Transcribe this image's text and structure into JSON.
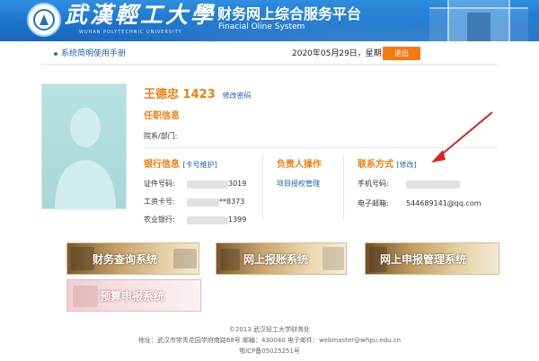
{
  "header": {
    "school_name": "武漢輕工大學",
    "school_name_en": "WUHAN POLYTECHNIC UNIVERSITY",
    "system_title": "财务网上综合服务平台",
    "system_subtitle": "Finacial Oline System",
    "logo_icon": "university-emblem"
  },
  "nav": {
    "manual_link": "系统简明使用手册",
    "date": "2020年05月29日，星期五",
    "logout": "退出"
  },
  "profile": {
    "name": "王德忠 1423",
    "change_password": "修改密码",
    "position_title": "任职信息",
    "department_label": "院系/部门:",
    "department_value": "",
    "bank": {
      "title": "银行信息",
      "maintain_link": "[卡号维护]",
      "id_label": "证件号码:",
      "id_value": "3019",
      "payroll_label": "工资卡号:",
      "payroll_value": "**8373",
      "abc_label": "农业银行:",
      "abc_value": "1399"
    },
    "manager": {
      "title": "负责人操作",
      "project_link": "项目授权管理"
    },
    "contact": {
      "title": "联系方式",
      "edit_link": "[修改]",
      "phone_label": "手机号码:",
      "phone_value": "",
      "email_label": "电子邮箱:",
      "email_value": "544689141@qq.com"
    }
  },
  "shortcuts": {
    "query": "财务查询系统",
    "expense": "网上报账系统",
    "report": "网上申报管理系统",
    "budget": "预算申报系统"
  },
  "footer": {
    "copyright": "©2013 武汉轻工大学财务处",
    "address": "地址：武汉市常青花园学府南路68号 邮编：430040 电子邮件：webmaster@whpu.edu.cn",
    "icp": "鄂ICP备05025251号"
  },
  "colors": {
    "header_blue": "#1e74cc",
    "accent_orange": "#f07d0f",
    "link_blue": "#1d5fb8",
    "annotation_red": "#e02020"
  }
}
